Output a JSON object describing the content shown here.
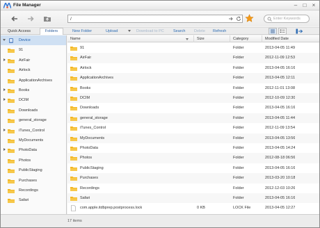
{
  "app": {
    "title": "File Manager"
  },
  "address": {
    "path": "/"
  },
  "search": {
    "placeholder": "Enter Keywords"
  },
  "tabs": {
    "quick_access": "Quick Access",
    "folders": "Folders"
  },
  "actions": {
    "new_folder": "New Folder",
    "upload": "Upload",
    "download_to_pc": "Download to PC",
    "search": "Search",
    "delete": "Delete",
    "refresh": "Refresh"
  },
  "sidebar": {
    "items": [
      {
        "label": "Device",
        "icon": "device-icon",
        "expandable": true,
        "expanded": true,
        "selected": true
      },
      {
        "label": "91",
        "icon": "folder-icon",
        "expandable": false
      },
      {
        "label": "AirFair",
        "icon": "folder-icon",
        "expandable": true
      },
      {
        "label": "Airlock",
        "icon": "folder-icon",
        "expandable": false
      },
      {
        "label": "ApplicationArchives",
        "icon": "folder-icon",
        "expandable": false
      },
      {
        "label": "Books",
        "icon": "folder-icon",
        "expandable": true
      },
      {
        "label": "DCIM",
        "icon": "folder-icon",
        "expandable": true
      },
      {
        "label": "Downloads",
        "icon": "folder-icon",
        "expandable": false
      },
      {
        "label": "general_storage",
        "icon": "folder-icon",
        "expandable": false
      },
      {
        "label": "iTunes_Control",
        "icon": "folder-icon",
        "expandable": true
      },
      {
        "label": "MyDocuments",
        "icon": "folder-icon",
        "expandable": false
      },
      {
        "label": "PhotoData",
        "icon": "folder-icon",
        "expandable": true
      },
      {
        "label": "Photos",
        "icon": "folder-icon",
        "expandable": false
      },
      {
        "label": "PublicStaging",
        "icon": "folder-icon",
        "expandable": false
      },
      {
        "label": "Purchases",
        "icon": "folder-icon",
        "expandable": false
      },
      {
        "label": "Recordings",
        "icon": "folder-icon",
        "expandable": false
      },
      {
        "label": "Safari",
        "icon": "folder-icon",
        "expandable": false
      }
    ]
  },
  "table": {
    "columns": [
      "Name",
      "Size",
      "Category",
      "Modified Date"
    ],
    "rows": [
      {
        "name": "91",
        "size": "",
        "category": "Folder",
        "date": "2013-04-05 11:49",
        "icon": "folder-icon"
      },
      {
        "name": "AirFair",
        "size": "",
        "category": "Folder",
        "date": "2012-11-09 12:53",
        "icon": "folder-icon"
      },
      {
        "name": "Airlock",
        "size": "",
        "category": "Folder",
        "date": "2013-04-05 16:16",
        "icon": "folder-icon"
      },
      {
        "name": "ApplicationArchives",
        "size": "",
        "category": "Folder",
        "date": "2013-04-05 12:11",
        "icon": "folder-icon"
      },
      {
        "name": "Books",
        "size": "",
        "category": "Folder",
        "date": "2012-11-01 13:08",
        "icon": "folder-icon"
      },
      {
        "name": "DCIM",
        "size": "",
        "category": "Folder",
        "date": "2012-10-09 12:30",
        "icon": "folder-icon"
      },
      {
        "name": "Downloads",
        "size": "",
        "category": "Folder",
        "date": "2013-04-05 16:16",
        "icon": "folder-icon"
      },
      {
        "name": "general_storage",
        "size": "",
        "category": "Folder",
        "date": "2013-04-05 11:44",
        "icon": "folder-icon"
      },
      {
        "name": "iTunes_Control",
        "size": "",
        "category": "Folder",
        "date": "2012-11-09 13:54",
        "icon": "folder-icon"
      },
      {
        "name": "MyDocuments",
        "size": "",
        "category": "Folder",
        "date": "2013-04-05 13:56",
        "icon": "folder-icon"
      },
      {
        "name": "PhotoData",
        "size": "",
        "category": "Folder",
        "date": "2013-04-05 14:24",
        "icon": "folder-icon"
      },
      {
        "name": "Photos",
        "size": "",
        "category": "Folder",
        "date": "2012-08-18 06:56",
        "icon": "folder-icon"
      },
      {
        "name": "PublicStaging",
        "size": "",
        "category": "Folder",
        "date": "2013-04-05 16:16",
        "icon": "folder-icon"
      },
      {
        "name": "Purchases",
        "size": "",
        "category": "Folder",
        "date": "2013-03-20 10:18",
        "icon": "folder-icon"
      },
      {
        "name": "Recordings",
        "size": "",
        "category": "Folder",
        "date": "2012-12-03 10:26",
        "icon": "folder-icon"
      },
      {
        "name": "Safari",
        "size": "",
        "category": "Folder",
        "date": "2013-04-05 16:16",
        "icon": "folder-icon"
      },
      {
        "name": "com.apple.itdbprep.postprocess.lock",
        "size": "0 KB",
        "category": "LOCK File",
        "date": "2013-04-05 12:27",
        "icon": "document-icon"
      }
    ]
  },
  "status": {
    "count": "17 items"
  },
  "colors": {
    "accent": "#2e6db4",
    "folder": "#f3b51c",
    "selection": "#cfe0f3",
    "star": "#f39a1a"
  }
}
